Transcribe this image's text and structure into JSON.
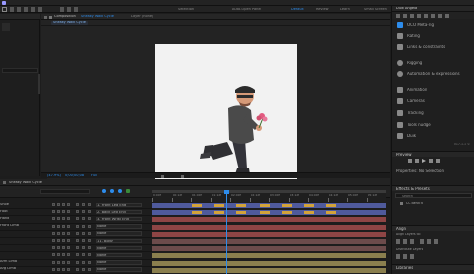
{
  "app": {
    "accent": "#2d8ceb",
    "playhead_color": "#2d8ceb"
  },
  "toolbar": {
    "items": [
      "Selection",
      "Auto-Open Panel",
      "Default",
      "Review",
      "Learn",
      "Small Screen"
    ]
  },
  "composition": {
    "tab_label": "Composition",
    "tab_name": "Sneaky Walk Cycle",
    "breadcrumb": "Sneaky Walk Cycle",
    "layer_tab": "Layer (none)",
    "zoom": "(47.9%)",
    "quality": "Full",
    "timecode": "0;00;00;08"
  },
  "right_panel": {
    "search_placeholder": "Search Help",
    "header_title": "Duik Angela",
    "items": [
      {
        "icon": "bone-icon",
        "label": "OCO Meta-rig",
        "color": "#a8a8a8"
      },
      {
        "icon": "link-icon",
        "label": "Rating",
        "color": "#a8a8a8"
      },
      {
        "icon": "chain-icon",
        "label": "Links & constraints",
        "color": "#a8a8a8"
      },
      {
        "icon": "wheel-icon",
        "label": "Rigging",
        "color": "#a8a8a8"
      },
      {
        "icon": "gear-icon",
        "label": "Automation & expressions",
        "color": "#a8a8a8"
      },
      {
        "icon": "pin-icon",
        "label": "Animation",
        "color": "#a8a8a8"
      },
      {
        "icon": "camera-icon",
        "label": "Cameras",
        "color": "#a8a8a8"
      },
      {
        "icon": "ear-icon",
        "label": "Tracking",
        "color": "#a8a8a8"
      },
      {
        "icon": "tools-icon",
        "label": "Tools nudge",
        "color": "#a8a8a8"
      },
      {
        "icon": "brush-icon",
        "label": "Duik",
        "color": "#a8a8a8"
      }
    ],
    "version": "v17.1.1 ©",
    "preview_header": "Preview",
    "preview_sub": "Properties: No Selection",
    "effects_header": "Effects & Presets",
    "effects_search": "Search",
    "effects_item": "CC Bend It",
    "align_header": "Align",
    "align_layers_to": "Align Layers to:",
    "distribute_header": "Distribute Layers",
    "libraries_header": "Libraries"
  },
  "timeline": {
    "tab_label": "Sneaky Walk Cycle",
    "time_ruler": [
      "0:00f",
      "00:12f",
      "01:00f",
      "01:12f",
      "02:00f",
      "02:12f",
      "03:00f",
      "03:12f",
      "04:00f",
      "04:12f",
      "05:00f",
      "05:12f"
    ],
    "layers": [
      {
        "name": "Shoe",
        "parent": "1. Front Leg End",
        "bar_color": "#4f5a9c"
      },
      {
        "name": "Foot",
        "parent": "2. Back Leg End",
        "bar_color": "#4f5a9c"
      },
      {
        "name": "Hand",
        "parent": "3. Front Wrist End",
        "bar_color": "#8e4545"
      },
      {
        "name": "Front Limb",
        "parent": "None",
        "bar_color": "#8e4545"
      },
      {
        "name": "",
        "parent": "None",
        "bar_color": "#8e4545"
      },
      {
        "name": "",
        "parent": "11. Body",
        "bar_color": "#6c4b4b"
      },
      {
        "name": "",
        "parent": "None",
        "bar_color": "#6c4b4b"
      },
      {
        "name": "",
        "parent": "None",
        "bar_color": "#8a7f4e"
      },
      {
        "name": "Arm Limb",
        "parent": "None",
        "bar_color": "#8a7f4e"
      },
      {
        "name": "Arg Limb",
        "parent": "None",
        "bar_color": "#8a7f4e"
      }
    ]
  }
}
